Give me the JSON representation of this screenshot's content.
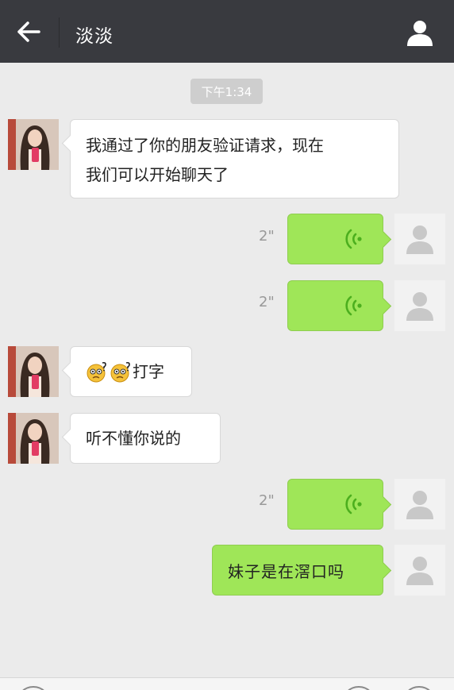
{
  "header": {
    "title": "淡淡",
    "back_icon": "arrow-left-icon",
    "profile_icon": "person-icon"
  },
  "chat": {
    "timestamp": "下午1:34",
    "messages": [
      {
        "sender": "other",
        "type": "text",
        "text_line1": "我通过了你的朋友验证请求，现在",
        "text_line2": "我们可以开始聊天了"
      },
      {
        "sender": "me",
        "type": "voice",
        "duration": "2\""
      },
      {
        "sender": "me",
        "type": "voice",
        "duration": "2\""
      },
      {
        "sender": "other",
        "type": "text",
        "emojis": [
          "confused-face-emoji",
          "confused-face-emoji"
        ],
        "text": "打字"
      },
      {
        "sender": "other",
        "type": "text",
        "text": "听不懂你说的"
      },
      {
        "sender": "me",
        "type": "voice",
        "duration": "2\""
      },
      {
        "sender": "me",
        "type": "text",
        "text": "妹子是在滘口吗"
      }
    ]
  },
  "colors": {
    "topbar": "#393a3f",
    "background": "#ebebeb",
    "outgoing_bubble": "#9fe658",
    "incoming_bubble": "#ffffff",
    "voice_wave": "#4caf1e"
  }
}
